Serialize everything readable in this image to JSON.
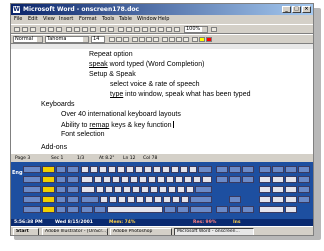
{
  "window": {
    "title": "Microsoft Word - onscreen178.doc"
  },
  "menu": [
    "File",
    "Edit",
    "View",
    "Insert",
    "Format",
    "Tools",
    "Table",
    "Window",
    "Help"
  ],
  "formatting": {
    "style": "Normal",
    "font": "Tahoma",
    "size": "14",
    "zoom": "100%"
  },
  "document": {
    "lines": [
      {
        "text": "Repeat option",
        "underline": ""
      },
      {
        "text": " word typed (Word Completion)",
        "underline": "speak"
      },
      {
        "text": "Setup & Speak",
        "underline": ""
      },
      {
        "text": "select voice & rate of speech",
        "underline": ""
      },
      {
        "text": " into window, speak what has been typed",
        "underline": "type"
      },
      {
        "text": "Keyboards",
        "underline": ""
      },
      {
        "text": "Over 40 international keyboard layouts",
        "underline": ""
      },
      {
        "text": "Ability to ",
        "underline": "",
        "tail_u": "remap",
        "tail": " keys & key function"
      },
      {
        "text": "Font selection",
        "underline": ""
      },
      {
        "text": "Add-ons",
        "underline": ""
      }
    ]
  },
  "status": {
    "page": "Page 3",
    "sec": "Sec 1",
    "pages": "1/3",
    "at": "At 8.2\"",
    "ln": "Ln 12",
    "col": "Col 78"
  },
  "keyboard": {
    "side_label": "Eng",
    "status_time": "5:56:38 PM",
    "status_date": "Wed 8/15/2001",
    "status_mem": "Mem: 74%",
    "status_num": "Res: 99%",
    "status_ins": "Ins"
  },
  "taskbar": {
    "start": "Start",
    "tasks": [
      "Adobe Illustrator - [OnScr...]",
      "Adobe Photoshop",
      "Microsoft Word - onscreen..."
    ]
  }
}
